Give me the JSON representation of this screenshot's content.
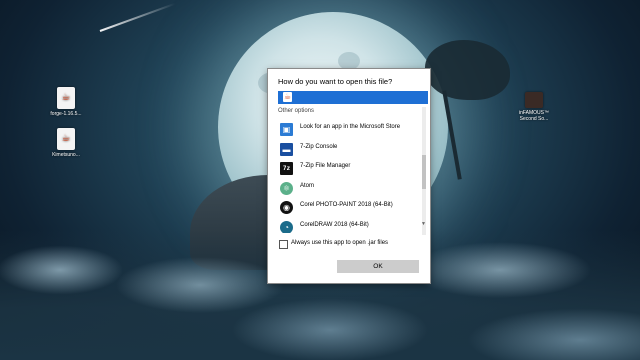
{
  "desktop": {
    "icons": [
      {
        "label": "forge-1.16.5...",
        "icon": "java-file-icon"
      },
      {
        "label": "Kimetsuno...",
        "icon": "java-file-icon"
      },
      {
        "label": "inFAMOUS™ Second So...",
        "icon": "game-shortcut-icon"
      }
    ]
  },
  "dialog": {
    "title": "How do you want to open this file?",
    "selected_app_icon": "java-icon",
    "section_label": "Other options",
    "apps": [
      {
        "label": "Look for an app in the Microsoft Store",
        "icon": "store-icon",
        "glyph": "▣"
      },
      {
        "label": "7-Zip Console",
        "icon": "7zip-console-icon",
        "glyph": "▬"
      },
      {
        "label": "7-Zip File Manager",
        "icon": "7zip-file-manager-icon",
        "glyph": "7z"
      },
      {
        "label": "Atom",
        "icon": "atom-icon",
        "glyph": "⚛"
      },
      {
        "label": "Corel PHOTO-PAINT 2018 (64-Bit)",
        "icon": "corel-photo-paint-icon",
        "glyph": "◉"
      },
      {
        "label": "CorelDRAW 2018 (64-Bit)",
        "icon": "coreldraw-icon",
        "glyph": "◔"
      }
    ],
    "always_use_label": "Always use this app to open .jar files",
    "always_use_checked": false,
    "ok_label": "OK"
  },
  "colors": {
    "selection": "#1e6fd4",
    "ok_button": "#cccccc"
  }
}
